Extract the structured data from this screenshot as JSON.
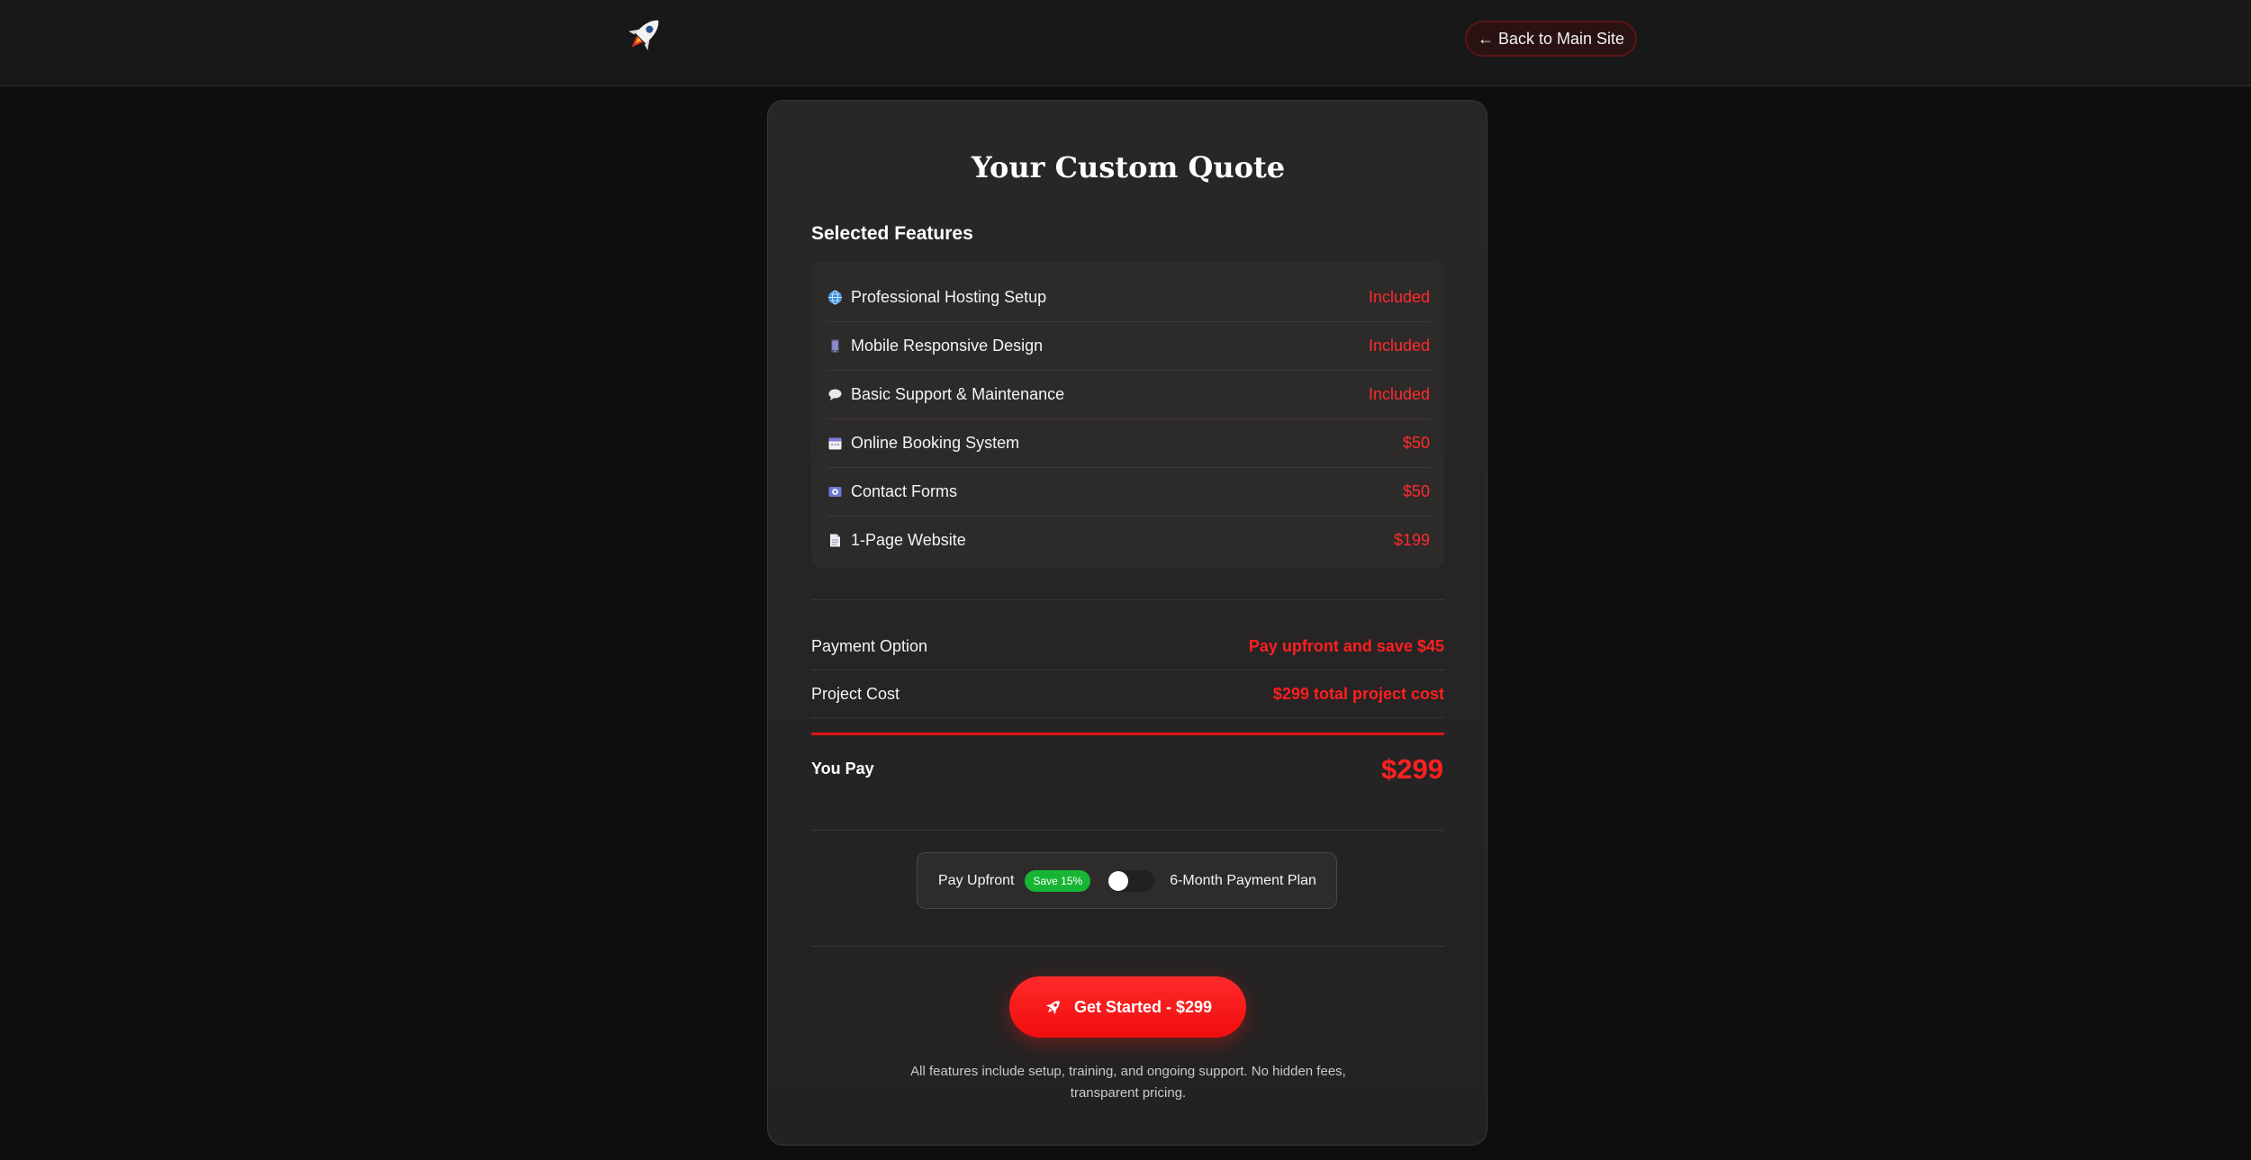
{
  "header": {
    "back_label": "← Back to Main Site"
  },
  "quote": {
    "title": "Your Custom Quote",
    "section_title": "Selected Features",
    "features": [
      {
        "icon": "globe-icon",
        "label": "Professional Hosting Setup",
        "price": "Included"
      },
      {
        "icon": "mobile-icon",
        "label": "Mobile Responsive Design",
        "price": "Included"
      },
      {
        "icon": "chat-bubble-icon",
        "label": "Basic Support & Maintenance",
        "price": "Included"
      },
      {
        "icon": "calendar-icon",
        "label": "Online Booking System",
        "price": "$50"
      },
      {
        "icon": "contact-form-icon",
        "label": "Contact Forms",
        "price": "$50"
      },
      {
        "icon": "document-icon",
        "label": "1-Page Website",
        "price": "$199"
      }
    ],
    "payment_option_label": "Payment Option",
    "payment_option_value": "Pay upfront and save $45",
    "project_cost_label": "Project Cost",
    "project_cost_value": "$299 total project cost",
    "you_pay_label": "You Pay",
    "you_pay_value": "$299"
  },
  "toggle": {
    "upfront_label": "Pay Upfront",
    "save_badge": "Save 15%",
    "plan_label": "6-Month Payment Plan",
    "state": "upfront"
  },
  "cta": {
    "label": "Get Started - $299"
  },
  "footnote": "All features include setup, training, and ongoing support. No hidden fees, transparent pricing.",
  "colors": {
    "accent": "#ff1f1f",
    "background": "#0e0e0e",
    "card": "#292626",
    "badge_green": "#17b534"
  }
}
